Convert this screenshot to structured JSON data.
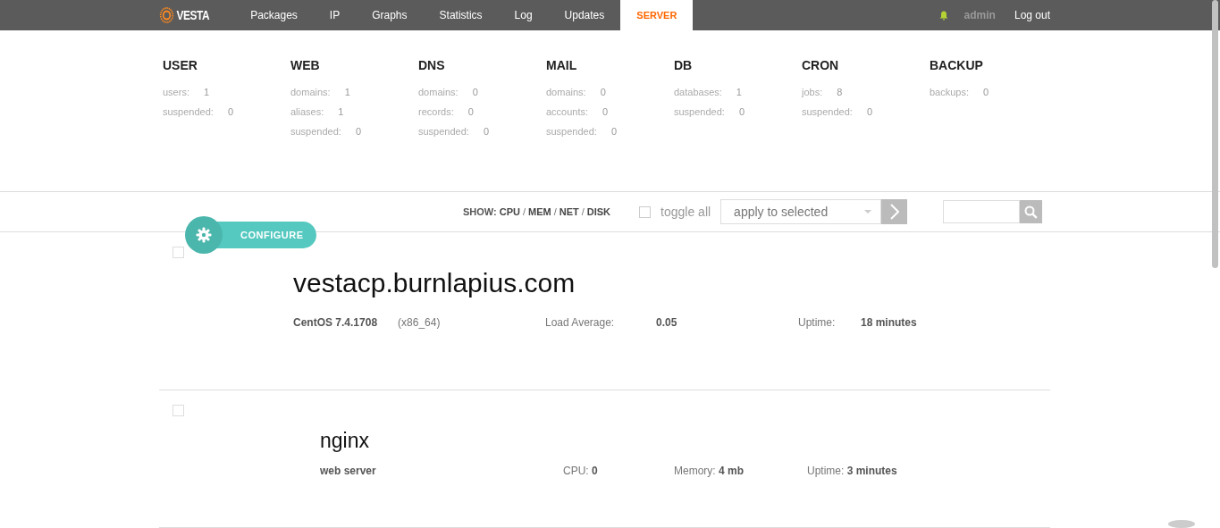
{
  "nav": {
    "logo": "VESTA",
    "tabs": [
      {
        "label": "Packages",
        "selected": false
      },
      {
        "label": "IP",
        "selected": false
      },
      {
        "label": "Graphs",
        "selected": false
      },
      {
        "label": "Statistics",
        "selected": false
      },
      {
        "label": "Log",
        "selected": false
      },
      {
        "label": "Updates",
        "selected": false
      },
      {
        "label": "SERVER",
        "selected": true
      }
    ],
    "user": "admin",
    "logout": "Log out"
  },
  "summary": [
    {
      "title": "USER",
      "stats": [
        {
          "label": "users:",
          "value": "1"
        },
        {
          "label": "suspended:",
          "value": "0"
        }
      ]
    },
    {
      "title": "WEB",
      "stats": [
        {
          "label": "domains:",
          "value": "1"
        },
        {
          "label": "aliases:",
          "value": "1"
        },
        {
          "label": "suspended:",
          "value": "0"
        }
      ]
    },
    {
      "title": "DNS",
      "stats": [
        {
          "label": "domains:",
          "value": "0"
        },
        {
          "label": "records:",
          "value": "0"
        },
        {
          "label": "suspended:",
          "value": "0"
        }
      ]
    },
    {
      "title": "MAIL",
      "stats": [
        {
          "label": "domains:",
          "value": "0"
        },
        {
          "label": "accounts:",
          "value": "0"
        },
        {
          "label": "suspended:",
          "value": "0"
        }
      ]
    },
    {
      "title": "DB",
      "stats": [
        {
          "label": "databases:",
          "value": "1"
        },
        {
          "label": "suspended:",
          "value": "0"
        }
      ]
    },
    {
      "title": "CRON",
      "stats": [
        {
          "label": "jobs:",
          "value": "8"
        },
        {
          "label": "suspended:",
          "value": "0"
        }
      ]
    },
    {
      "title": "BACKUP",
      "stats": [
        {
          "label": "backups:",
          "value": "0"
        }
      ]
    }
  ],
  "toolbar": {
    "configure": "CONFIGURE",
    "show_label": "SHOW:",
    "show_items": [
      {
        "kind": "link",
        "text": "CPU"
      },
      {
        "kind": "separator",
        "text": "/"
      },
      {
        "kind": "link",
        "text": "MEM"
      },
      {
        "kind": "separator",
        "text": "/"
      },
      {
        "kind": "link",
        "text": "NET"
      },
      {
        "kind": "separator",
        "text": "/"
      },
      {
        "kind": "link",
        "text": "DISK"
      }
    ],
    "toggle_all": {
      "label": "toggle all",
      "checked": false
    },
    "action_select": {
      "value": "apply to selected"
    }
  },
  "server": {
    "checked": false,
    "hostname": "vestacp.burnlapius.com",
    "os": "CentOS 7.4.1708",
    "arch": "(x86_64)",
    "load_label": "Load Average:",
    "load": "0.05",
    "uptime_label": "Uptime:",
    "uptime": "18 minutes"
  },
  "services": [
    {
      "checked": false,
      "name": "nginx",
      "type": "web server",
      "cpu_label": "CPU:",
      "cpu": "0",
      "memory_label": "Memory:",
      "memory": "4 mb",
      "uptime_label": "Uptime:",
      "uptime": "3 minutes"
    }
  ]
}
